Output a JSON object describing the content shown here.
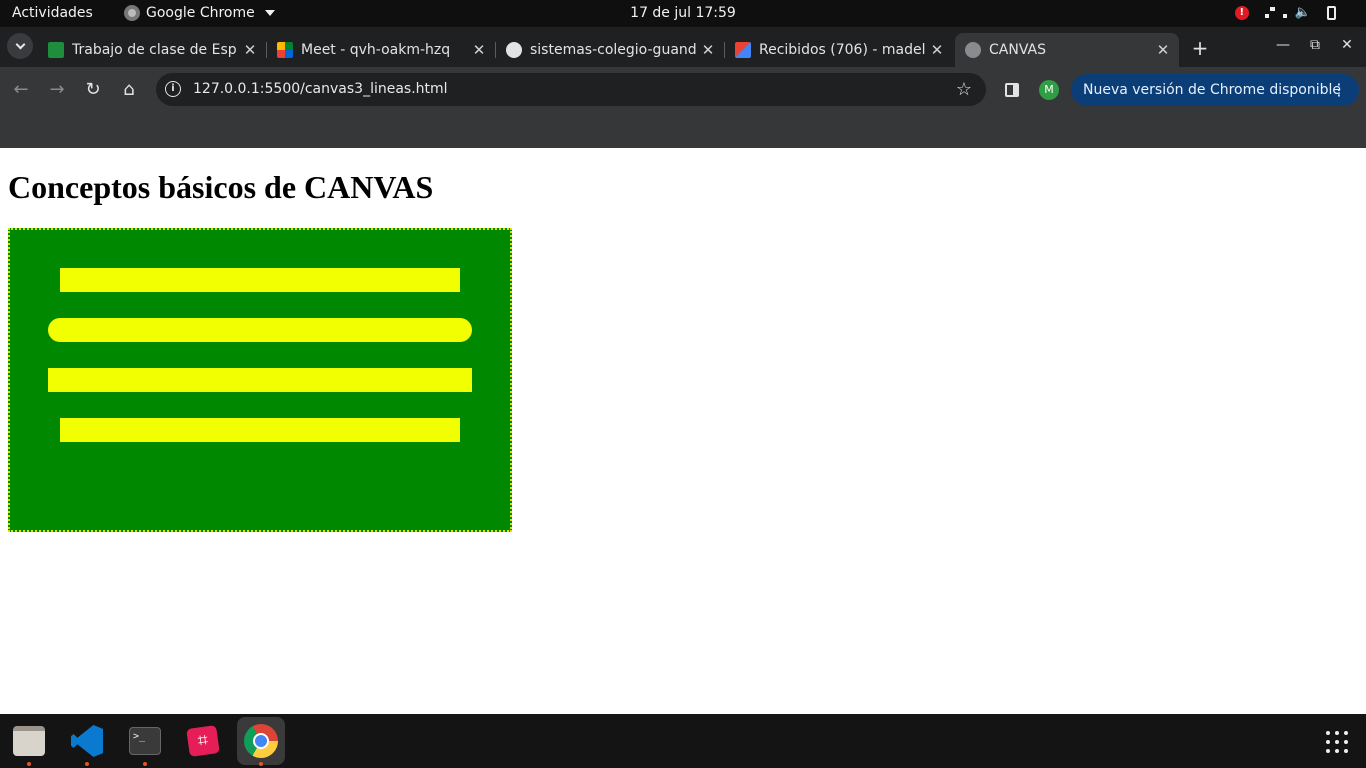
{
  "topbar": {
    "activities": "Actividades",
    "app_name": "Google Chrome",
    "clock": "17 de jul  17:59"
  },
  "tabs": [
    {
      "title": "Trabajo de clase de Esp",
      "favicon": "classroom-icon",
      "active": false
    },
    {
      "title": "Meet - qvh-oakm-hzq",
      "favicon": "meet-icon",
      "active": false
    },
    {
      "title": "sistemas-colegio-guand",
      "favicon": "github-icon",
      "active": false
    },
    {
      "title": "Recibidos (706) - madel",
      "favicon": "gmail-icon",
      "active": false
    },
    {
      "title": "CANVAS",
      "favicon": "globe-icon",
      "active": true
    }
  ],
  "toolbar": {
    "url": "127.0.0.1:5500/canvas3_lineas.html",
    "profile_initial": "M",
    "update_label": "Nueva versión de Chrome disponible"
  },
  "page": {
    "heading": "Conceptos básicos de CANVAS",
    "canvas": {
      "background": "#008800",
      "border_color": "#d9e600",
      "line_color": "#f2ff00"
    }
  },
  "dock": {
    "apps": [
      "files-icon",
      "vscode-icon",
      "terminal-icon",
      "screenshot-crop-icon",
      "chrome-icon"
    ]
  }
}
